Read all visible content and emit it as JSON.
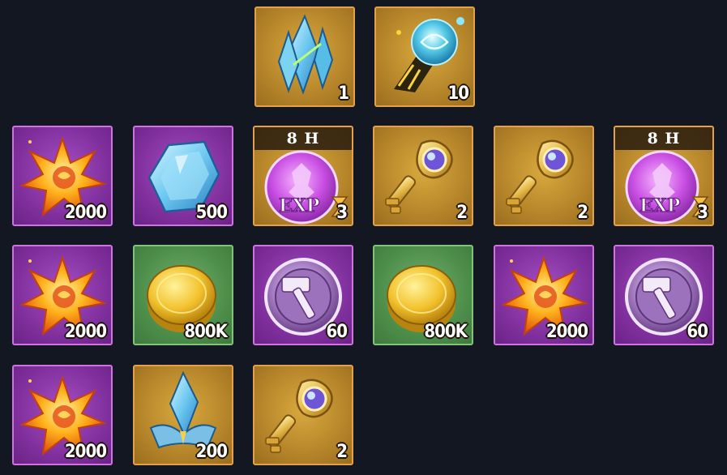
{
  "rewards": {
    "row1": [
      {
        "item": "blue-crystal-shard",
        "rarity": "gold",
        "quantity": "1"
      },
      {
        "item": "spirit-orb-fragment",
        "rarity": "gold",
        "quantity": "10"
      }
    ],
    "row2": [
      {
        "item": "golden-star",
        "rarity": "purple",
        "quantity": "2000"
      },
      {
        "item": "blue-gem",
        "rarity": "purple",
        "quantity": "500"
      },
      {
        "item": "exp-potion-timed",
        "rarity": "gold",
        "timer": "8 H",
        "quantity": "3"
      },
      {
        "item": "golden-key",
        "rarity": "gold",
        "quantity": "2"
      },
      {
        "item": "golden-key",
        "rarity": "gold",
        "quantity": "2"
      },
      {
        "item": "exp-potion-timed",
        "rarity": "gold",
        "timer": "8 H",
        "quantity": "3"
      }
    ],
    "row3": [
      {
        "item": "golden-star",
        "rarity": "purple",
        "quantity": "2000"
      },
      {
        "item": "gold-coin",
        "rarity": "green",
        "quantity": "800K"
      },
      {
        "item": "hammer-token",
        "rarity": "purple",
        "quantity": "60"
      },
      {
        "item": "gold-coin",
        "rarity": "green",
        "quantity": "800K"
      },
      {
        "item": "golden-star",
        "rarity": "purple",
        "quantity": "2000"
      },
      {
        "item": "hammer-token",
        "rarity": "purple",
        "quantity": "60"
      }
    ],
    "row4": [
      {
        "item": "golden-star",
        "rarity": "purple",
        "quantity": "2000"
      },
      {
        "item": "crystal-crown",
        "rarity": "gold",
        "quantity": "200"
      },
      {
        "item": "golden-key",
        "rarity": "gold",
        "quantity": "2"
      }
    ]
  },
  "colors": {
    "background": "#131722",
    "gold_tile": "#b6852a",
    "purple_tile": "#7f2f9c",
    "green_tile": "#4c8c49"
  }
}
